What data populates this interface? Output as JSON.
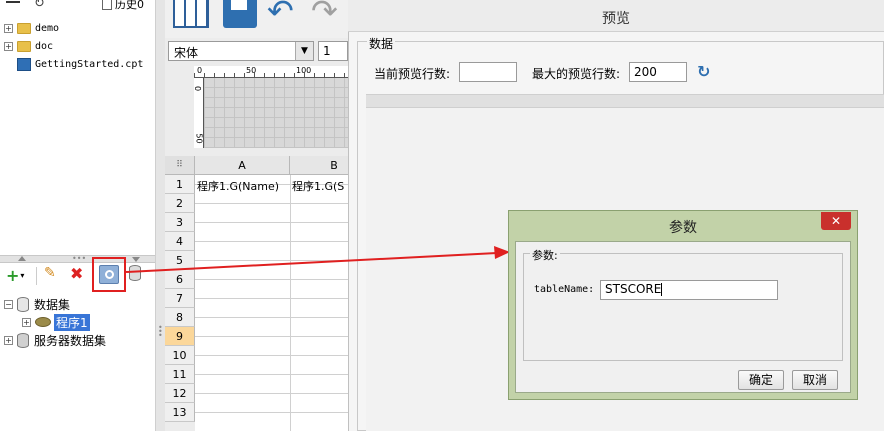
{
  "left_tree": {
    "history_label": "历史0",
    "items": [
      {
        "label": "demo"
      },
      {
        "label": "doc"
      },
      {
        "label": "GettingStarted.cpt"
      }
    ]
  },
  "dataset_tree": {
    "root": "数据集",
    "child": "程序1",
    "server": "服务器数据集"
  },
  "font_bar": {
    "font_name": "宋体",
    "font_size": "1"
  },
  "ruler": {
    "h_ticks": [
      "0",
      "50",
      "100"
    ],
    "v_ticks": [
      "0",
      "50"
    ]
  },
  "sheet": {
    "columns": [
      "A",
      "B"
    ],
    "rows": [
      "1",
      "2",
      "3",
      "4",
      "5",
      "6",
      "7",
      "8",
      "9",
      "10",
      "11",
      "12",
      "13"
    ],
    "cell_a1": "程序1.G(Name)",
    "cell_b1": "程序1.G(S"
  },
  "preview": {
    "title": "预览",
    "group_label": "数据",
    "current_rows_label": "当前预览行数:",
    "current_rows_value": "",
    "max_rows_label": "最大的预览行数:",
    "max_rows_value": "200"
  },
  "param_dialog": {
    "title": "参数",
    "group_label": "参数:",
    "field_label": "tableName:",
    "field_value": "STSCORE",
    "ok_label": "确定",
    "cancel_label": "取消"
  },
  "colors": {
    "annotation_red": "#e02020",
    "selection_blue": "#3875d7",
    "dialog_frame": "#c2d2a8",
    "close_red": "#c9302c"
  }
}
